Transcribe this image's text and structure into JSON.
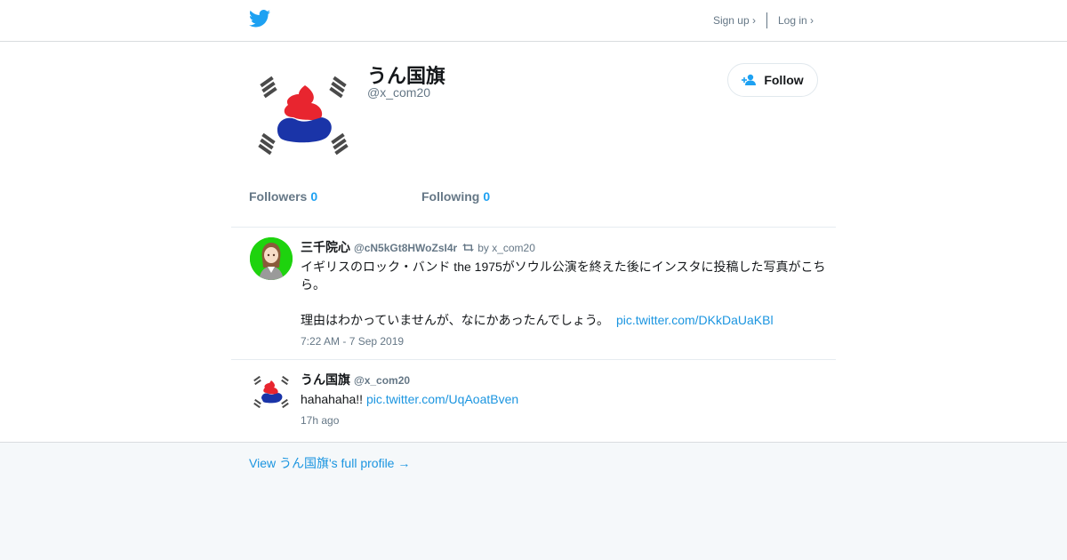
{
  "nav": {
    "signup": "Sign up ›",
    "login": "Log in ›"
  },
  "profile": {
    "name": "うん国旗",
    "handle": "@x_com20",
    "follow_label": "Follow",
    "followers_label": "Followers",
    "followers_count": "0",
    "following_label": "Following",
    "following_count": "0"
  },
  "tweets": [
    {
      "name": "三千院心",
      "handle": "@cN5kGt8HWoZsI4r",
      "retweet_by": "by x_com20",
      "text_line1": "イギリスのロック・バンド the 1975がソウル公演を終えた後にインスタに投稿した写真がこちら。",
      "text_line2": "理由はわかっていませんが、なにかあったんでしょう。",
      "link": "pic.twitter.com/DKkDaUaKBl",
      "time": "7:22 AM - 7 Sep 2019"
    },
    {
      "name": "うん国旗",
      "handle": "@x_com20",
      "text": "hahahaha!!",
      "link": "pic.twitter.com/UqAoatBven",
      "time": "17h ago"
    }
  ],
  "footer": {
    "full_profile": "View うん国旗's full profile →"
  },
  "colors": {
    "accent": "#1da1f2",
    "link": "#1b95e0",
    "muted": "#657786"
  },
  "icons": [
    "twitter-bird-icon",
    "add-user-icon",
    "retweet-icon"
  ]
}
